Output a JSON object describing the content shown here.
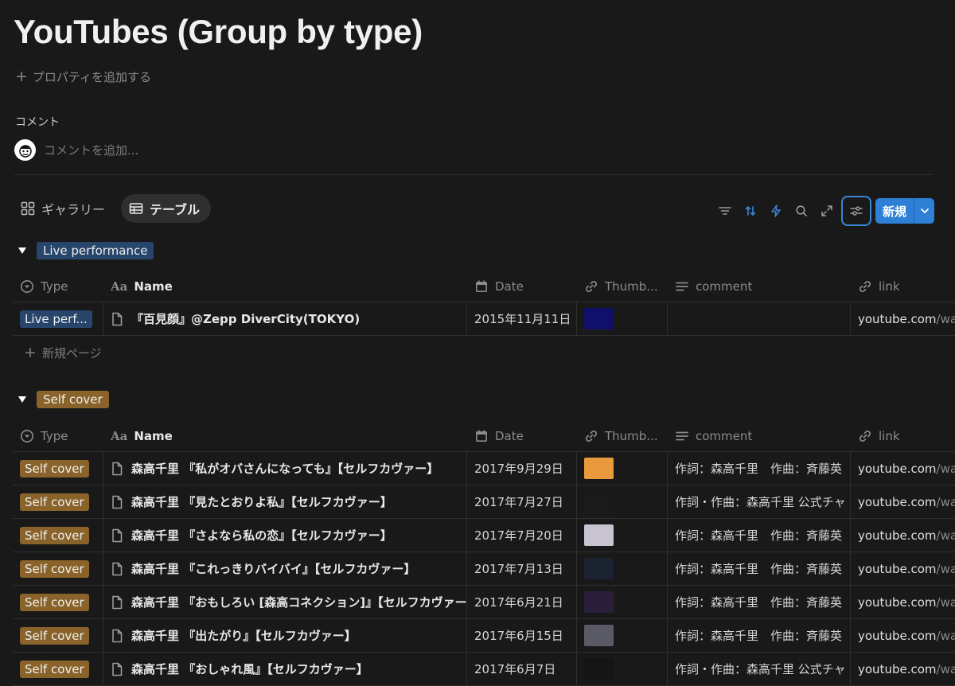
{
  "page": {
    "title": "YouTubes (Group by type)",
    "add_property": "プロパティを追加する",
    "comment_label": "コメント",
    "comment_placeholder": "コメントを追加..."
  },
  "views": [
    {
      "label": "ギャラリー",
      "icon": "grid-icon",
      "active": false
    },
    {
      "label": "テーブル",
      "icon": "table-icon",
      "active": true
    }
  ],
  "toolbar": {
    "icons": [
      "filter-icon",
      "sort-icon",
      "automation-icon",
      "search-icon",
      "expand-icon",
      "settings-icon"
    ],
    "new_label": "新規",
    "accent": "#2e7fd6"
  },
  "columns": [
    {
      "label": "Type",
      "icon": "select-icon"
    },
    {
      "label": "Name",
      "icon": "text-icon"
    },
    {
      "label": "Date",
      "icon": "calendar-icon"
    },
    {
      "label": "Thumb...",
      "icon": "link-icon"
    },
    {
      "label": "comment",
      "icon": "lines-icon"
    },
    {
      "label": "link",
      "icon": "link-icon"
    }
  ],
  "groups": [
    {
      "label": "Live performance",
      "color": "#28456c",
      "rows": [
        {
          "type": "Live perf...",
          "name": "『百見顔』@Zepp DiverCity(TOKYO)",
          "date": "2015年11月11日",
          "thumb_color": "#10106a",
          "comment": "",
          "link_base": "youtube.com",
          "link_rest": "/wa"
        }
      ],
      "new_page": "新規ページ"
    },
    {
      "label": "Self cover",
      "color": "#89632a",
      "rows": [
        {
          "type": "Self cover",
          "name": "森高千里 『私がオバさんになっても』【セルフカヴァー】",
          "date": "2017年9月29日",
          "thumb_color": "#e89a3c",
          "comment": "作詞：森高千里　作曲：斉藤英",
          "link_base": "youtube.com",
          "link_rest": "/wa"
        },
        {
          "type": "Self cover",
          "name": "森高千里 『見たとおりよ私』【セルフカヴァー】",
          "date": "2017年7月27日",
          "thumb_color": "#1a1a1a",
          "comment": "作詞・作曲：森高千里 公式チャ",
          "link_base": "youtube.com",
          "link_rest": "/wa"
        },
        {
          "type": "Self cover",
          "name": "森高千里 『さよなら私の恋』【セルフカヴァー】",
          "date": "2017年7月20日",
          "thumb_color": "#c9c4d2",
          "comment": "作詞：森高千里　作曲：斉藤英",
          "link_base": "youtube.com",
          "link_rest": "/wa"
        },
        {
          "type": "Self cover",
          "name": "森高千里 『これっきりバイバイ』【セルフカヴァー】",
          "date": "2017年7月13日",
          "thumb_color": "#1b2330",
          "comment": "作詞：森高千里　作曲：斉藤英",
          "link_base": "youtube.com",
          "link_rest": "/wa"
        },
        {
          "type": "Self cover",
          "name": "森高千里 『おもしろい [森高コネクション]』【セルフカヴァー】",
          "date": "2017年6月21日",
          "thumb_color": "#2a1f3a",
          "comment": "作詞：森高千里　作曲：斉藤英",
          "link_base": "youtube.com",
          "link_rest": "/wa"
        },
        {
          "type": "Self cover",
          "name": "森高千里 『出たがり』【セルフカヴァー】",
          "date": "2017年6月15日",
          "thumb_color": "#5a5a66",
          "comment": "作詞：森高千里　作曲：斉藤英",
          "link_base": "youtube.com",
          "link_rest": "/wa"
        },
        {
          "type": "Self cover",
          "name": "森高千里 『おしゃれ風』【セルフカヴァー】",
          "date": "2017年6月7日",
          "thumb_color": "#151515",
          "comment": "作詞・作曲：森高千里 公式チャ",
          "link_base": "youtube.com",
          "link_rest": "/wa"
        }
      ]
    }
  ]
}
